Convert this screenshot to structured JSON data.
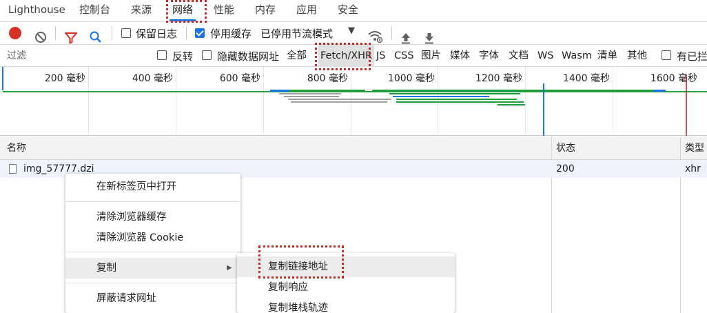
{
  "tabs": [
    {
      "label": "Lighthouse",
      "active": false
    },
    {
      "label": "控制台",
      "active": false
    },
    {
      "label": "来源",
      "active": false
    },
    {
      "label": "网络",
      "active": true
    },
    {
      "label": "性能",
      "active": false
    },
    {
      "label": "内存",
      "active": false
    },
    {
      "label": "应用",
      "active": false
    },
    {
      "label": "安全",
      "active": false
    }
  ],
  "toolbar": {
    "preserve_log_label": "保留日志",
    "preserve_log_checked": false,
    "disable_cache_label": "停用缓存",
    "disable_cache_checked": true,
    "throttling_value": "已停用节流模式"
  },
  "filter": {
    "placeholder": "过滤",
    "value": "",
    "invert_label": "反转",
    "hide_data_urls_label": "隐藏数据网址",
    "types": [
      "全部",
      "Fetch/XHR",
      "JS",
      "CSS",
      "图片",
      "媒体",
      "字体",
      "文档",
      "WS",
      "Wasm",
      "清单",
      "其他"
    ],
    "selected_type": "Fetch/XHR",
    "blocked_label": "有已拦"
  },
  "overview": {
    "ticks": [
      "200 毫秒",
      "400 毫秒",
      "600 毫秒",
      "800 毫秒",
      "1000 毫秒",
      "1200 毫秒",
      "1400 毫秒",
      "1600 毫秒"
    ]
  },
  "table": {
    "columns": [
      "名称",
      "状态",
      "类型"
    ],
    "rows": [
      {
        "name": "img_57777.dzi",
        "status": "200",
        "type": "xhr"
      }
    ]
  },
  "context_menu": {
    "items": [
      "在新标签页中打开",
      "清除浏览器缓存",
      "清除浏览器 Cookie",
      "复制",
      "屏蔽请求网址"
    ],
    "highlighted": "复制"
  },
  "submenu": {
    "items": [
      "复制链接地址",
      "复制响应",
      "复制堆栈轨迹"
    ],
    "highlighted": "复制链接地址"
  },
  "colors": {
    "accent": "#1a73e8",
    "record_red": "#d93025",
    "highlight_box": "#c62828",
    "timeline_green": "#1e9e3e"
  }
}
